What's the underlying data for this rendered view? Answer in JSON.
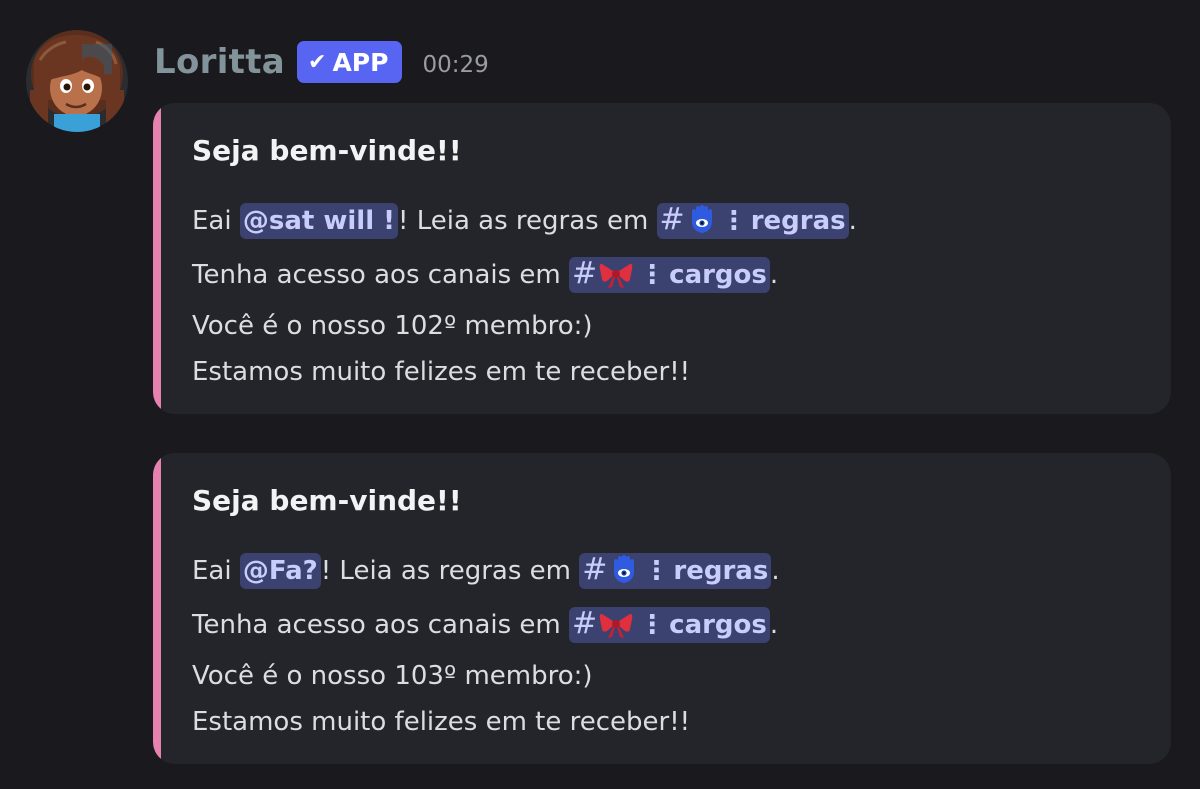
{
  "message": {
    "author": "Loritta",
    "badge": "APP",
    "badge_icon": "check-icon",
    "timestamp": "00:29",
    "colors": {
      "embed_accent": "#e682af",
      "badge_bg": "#5865f2",
      "mention_bg": "#3c4270"
    }
  },
  "embeds": [
    {
      "title": "Seja bem-vinde!!",
      "line1": {
        "pre": "Eai ",
        "mention": "@sat will !",
        "mid": "! Leia as regras em ",
        "channel_hash": "#",
        "channel_icon": "hamsa-icon",
        "channel_sep": "⋮",
        "channel_name": "regras",
        "post": "."
      },
      "line2": {
        "pre": "Tenha acesso aos canais em ",
        "channel_hash": "#",
        "channel_icon": "ribbon-icon",
        "channel_sep": "⋮",
        "channel_name": "cargos",
        "post": "."
      },
      "line3": "Você é o nosso 102º membro:)",
      "line4": "Estamos muito felizes em te receber!!"
    },
    {
      "title": "Seja bem-vinde!!",
      "line1": {
        "pre": "Eai ",
        "mention": "@Fa?",
        "mid": "! Leia as regras em ",
        "channel_hash": "#",
        "channel_icon": "hamsa-icon",
        "channel_sep": "⋮",
        "channel_name": "regras",
        "post": "."
      },
      "line2": {
        "pre": "Tenha acesso aos canais em ",
        "channel_hash": "#",
        "channel_icon": "ribbon-icon",
        "channel_sep": "⋮",
        "channel_name": "cargos",
        "post": "."
      },
      "line3": "Você é o nosso 103º membro:)",
      "line4": "Estamos muito felizes em te receber!!"
    }
  ]
}
